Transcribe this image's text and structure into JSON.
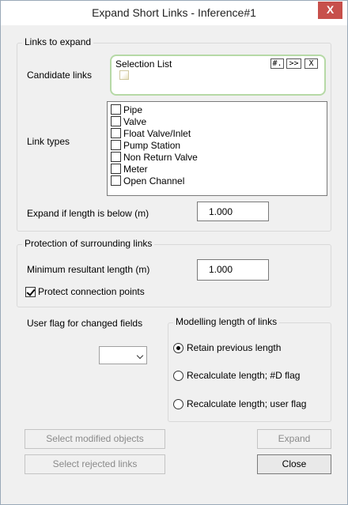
{
  "window": {
    "title": "Expand Short Links - Inference#1",
    "close_glyph": "X"
  },
  "links_to_expand": {
    "group_title": "Links to expand",
    "candidate_label": "Candidate links",
    "selection_list": {
      "title": "Selection List",
      "buttons": [
        "#.",
        ">>",
        "X"
      ]
    },
    "link_types_label": "Link types",
    "link_types": [
      {
        "label": "Pipe",
        "checked": false
      },
      {
        "label": "Valve",
        "checked": false
      },
      {
        "label": "Float Valve/Inlet",
        "checked": false
      },
      {
        "label": "Pump Station",
        "checked": false
      },
      {
        "label": "Non Return Valve",
        "checked": false
      },
      {
        "label": "Meter",
        "checked": false
      },
      {
        "label": "Open Channel",
        "checked": false
      }
    ],
    "length_label": "Expand if length is below (m)",
    "length_value": "1.000"
  },
  "protection": {
    "group_title": "Protection of surrounding links",
    "min_length_label": "Minimum resultant length (m)",
    "min_length_value": "1.000",
    "protect_label": "Protect connection points",
    "protect_checked": true
  },
  "user_flag": {
    "label": "User flag for changed fields",
    "selected": ""
  },
  "modelling": {
    "group_title": "Modelling length of links",
    "options": [
      {
        "label": "Retain previous length",
        "selected": true
      },
      {
        "label": "Recalculate length; #D flag",
        "selected": false
      },
      {
        "label": "Recalculate length; user flag",
        "selected": false
      }
    ]
  },
  "buttons": {
    "select_modified": "Select modified objects",
    "select_rejected": "Select rejected links",
    "expand": "Expand",
    "close": "Close"
  }
}
